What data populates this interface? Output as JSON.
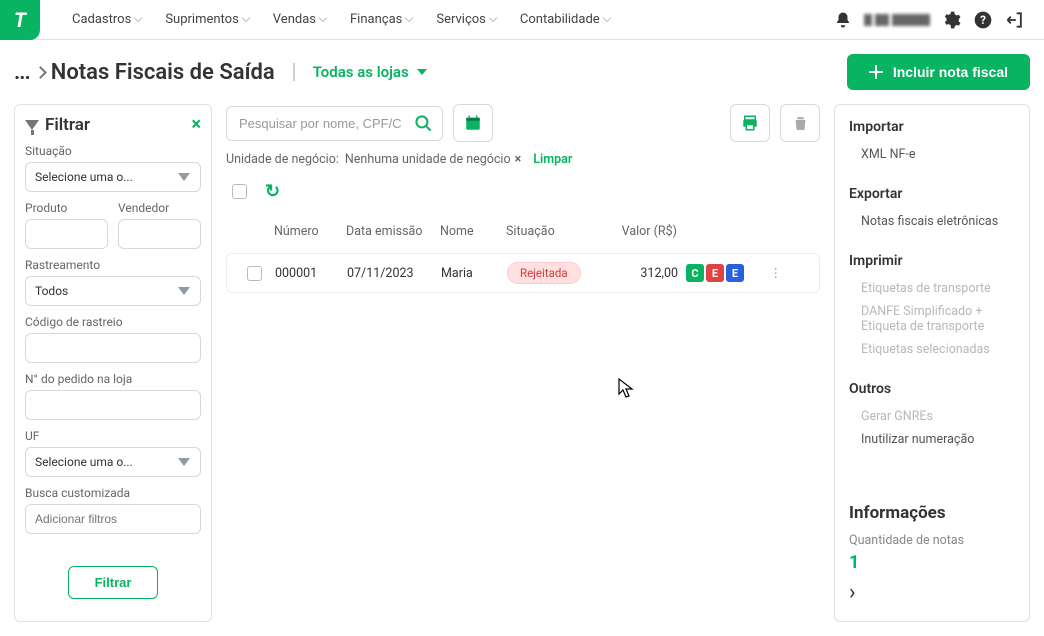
{
  "nav": {
    "items": [
      "Cadastros",
      "Suprimentos",
      "Vendas",
      "Finanças",
      "Serviços",
      "Contabilidade"
    ]
  },
  "page": {
    "dots": "...",
    "title": "Notas Fiscais de Saída",
    "store_selector": "Todas as lojas",
    "create_btn": "Incluir nota fiscal"
  },
  "filter": {
    "title": "Filtrar",
    "situacao_label": "Situação",
    "situacao_placeholder": "Selecione uma o...",
    "produto_label": "Produto",
    "vendedor_label": "Vendedor",
    "rastreamento_label": "Rastreamento",
    "rastreamento_value": "Todos",
    "codigo_label": "Código de rastreio",
    "pedido_label": "N° do pedido na loja",
    "uf_label": "UF",
    "uf_placeholder": "Selecione uma o...",
    "busca_label": "Busca customizada",
    "busca_placeholder": "Adicionar filtros",
    "btn": "Filtrar"
  },
  "toolbar": {
    "search_placeholder": "Pesquisar por nome, CPF/CNPJ o",
    "chip_label": "Unidade de negócio:",
    "chip_value": "Nenhuma unidade de negócio",
    "limpar": "Limpar"
  },
  "table": {
    "headers": {
      "numero": "Número",
      "data": "Data emissão",
      "nome": "Nome",
      "situacao": "Situação",
      "valor": "Valor (R$)"
    },
    "row": {
      "numero": "000001",
      "data": "07/11/2023",
      "nome": "Maria",
      "situacao": "Rejeitada",
      "valor": "312,00",
      "flags": [
        "C",
        "E",
        "E"
      ]
    }
  },
  "right": {
    "importar": "Importar",
    "xml": "XML NF-e",
    "exportar": "Exportar",
    "nfe": "Notas fiscais eletrônicas",
    "imprimir": "Imprimir",
    "etiq_transp": "Etiquetas de transporte",
    "danfe": "DANFE Simplificado + Etiqueta de transporte",
    "etiq_sel": "Etiquetas selecionadas",
    "outros": "Outros",
    "gnre": "Gerar GNREs",
    "inutil": "Inutilizar numeração",
    "info_head": "Informações",
    "qtd_label": "Quantidade de notas",
    "qtd_value": "1"
  }
}
